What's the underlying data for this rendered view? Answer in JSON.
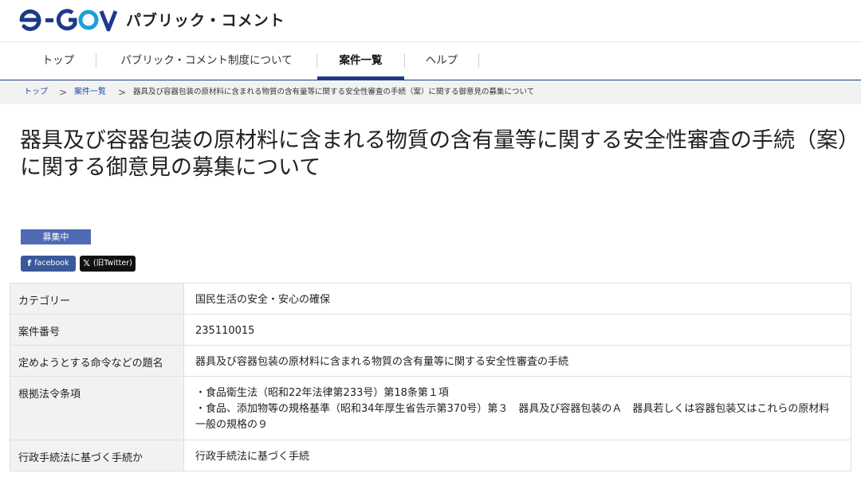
{
  "header": {
    "logo_text": "e-GOV",
    "site_title": "パブリック・コメント"
  },
  "nav": {
    "items": [
      "トップ",
      "パブリック・コメント制度について",
      "案件一覧",
      "ヘルプ"
    ],
    "active_index": 2
  },
  "breadcrumb": {
    "items": [
      "トップ",
      "案件一覧",
      "器具及び容器包装の原材料に含まれる物質の含有量等に関する安全性審査の手続（案）に関する御意見の募集について"
    ],
    "separator": ">"
  },
  "page": {
    "title": "器具及び容器包装の原材料に含まれる物質の含有量等に関する安全性審査の手続（案）に関する御意見の募集について",
    "status": "募集中"
  },
  "share": {
    "facebook_label": "facebook",
    "x_label": "(旧Twitter)"
  },
  "details": {
    "rows": [
      {
        "label": "カテゴリー",
        "value": "国民生活の安全・安心の確保"
      },
      {
        "label": "案件番号",
        "value": "235110015"
      },
      {
        "label": "定めようとする命令などの題名",
        "value": "器具及び容器包装の原材料に含まれる物質の含有量等に関する安全性審査の手続"
      },
      {
        "label": "根拠法令条項",
        "lines": [
          "・食品衛生法（昭和22年法律第233号）第18条第１項",
          "・食品、添加物等の規格基準（昭和34年厚生省告示第370号）第３　器具及び容器包装のＡ　器具若しくは容器包装又はこれらの原材料一般の規格の９"
        ]
      },
      {
        "label": "行政手続法に基づく手続か",
        "value": "行政手続法に基づく手続"
      }
    ]
  },
  "colors": {
    "brand_navy": "#1d3a8a",
    "logo_cyan": "#1aa0d8",
    "badge": "#4e6bb3",
    "facebook": "#3b5998",
    "x": "#111111"
  }
}
